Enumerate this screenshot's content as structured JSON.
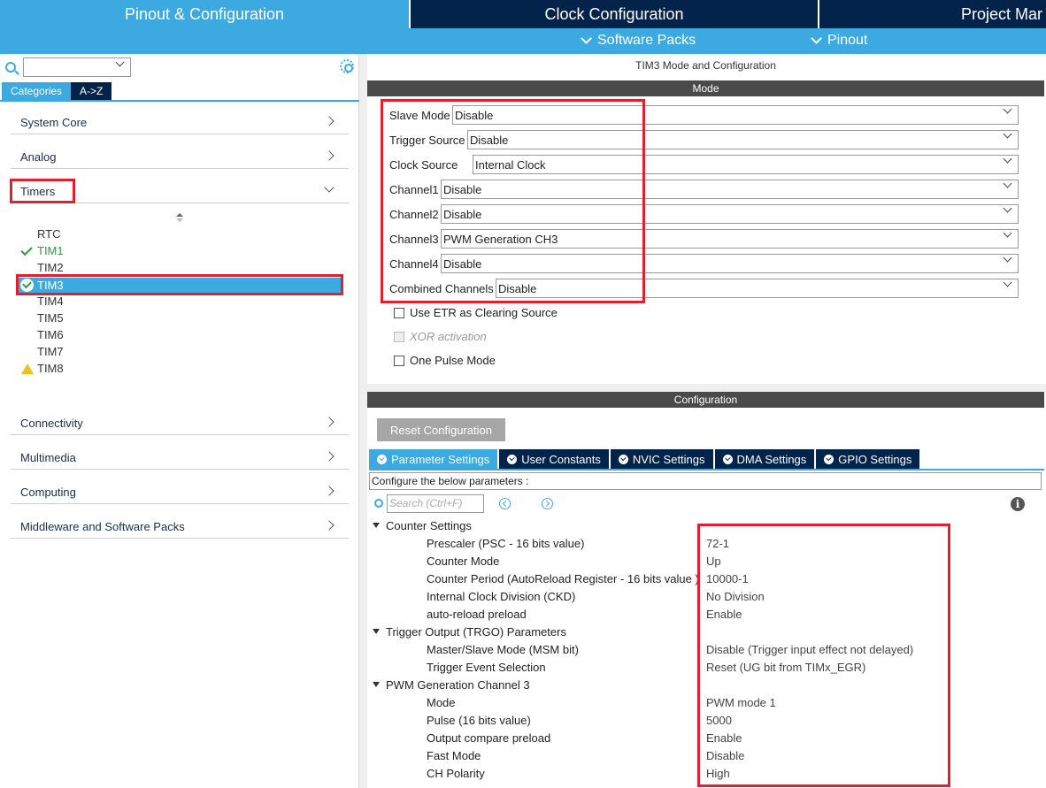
{
  "top_tabs": [
    "Pinout & Configuration",
    "Clock Configuration",
    "Project Mar"
  ],
  "sub_bar": {
    "software_packs": "Software Packs",
    "pinout": "Pinout"
  },
  "sidebar": {
    "tabs": [
      "Categories",
      "A->Z"
    ],
    "categories": [
      "System Core",
      "Analog",
      "Timers",
      "Connectivity",
      "Multimedia",
      "Computing",
      "Middleware and Software Packs"
    ],
    "timers": [
      "RTC",
      "TIM1",
      "TIM2",
      "TIM3",
      "TIM4",
      "TIM5",
      "TIM6",
      "TIM7",
      "TIM8"
    ]
  },
  "panel": {
    "title": "TIM3 Mode and Configuration",
    "mode_header": "Mode",
    "config_header": "Configuration"
  },
  "mode": {
    "rows": [
      {
        "label": "Slave Mode",
        "value": "Disable"
      },
      {
        "label": "Trigger Source",
        "value": "Disable"
      },
      {
        "label": "Clock Source",
        "value": "Internal Clock"
      },
      {
        "label": "Channel1",
        "value": "Disable"
      },
      {
        "label": "Channel2",
        "value": "Disable"
      },
      {
        "label": "Channel3",
        "value": "PWM Generation CH3"
      },
      {
        "label": "Channel4",
        "value": "Disable"
      },
      {
        "label": "Combined Channels",
        "value": "Disable"
      }
    ],
    "checkboxes": [
      "Use ETR as Clearing Source",
      "XOR activation",
      "One Pulse Mode"
    ]
  },
  "config": {
    "reset_label": "Reset Configuration",
    "tabs": [
      "Parameter Settings",
      "User Constants",
      "NVIC Settings",
      "DMA Settings",
      "GPIO Settings"
    ],
    "note": "Configure the below parameters :",
    "search_placeholder": "Search (Ctrl+F)",
    "groups": [
      {
        "name": "Counter Settings",
        "params": [
          {
            "name": "Prescaler (PSC - 16 bits value)",
            "value": "72-1"
          },
          {
            "name": "Counter Mode",
            "value": "Up"
          },
          {
            "name": "Counter Period (AutoReload Register - 16 bits value )",
            "value": "10000-1"
          },
          {
            "name": "Internal Clock Division (CKD)",
            "value": "No Division"
          },
          {
            "name": "auto-reload preload",
            "value": "Enable"
          }
        ]
      },
      {
        "name": "Trigger Output (TRGO) Parameters",
        "params": [
          {
            "name": "Master/Slave Mode (MSM bit)",
            "value": "Disable (Trigger input effect not delayed)"
          },
          {
            "name": "Trigger Event Selection",
            "value": "Reset (UG bit from TIMx_EGR)"
          }
        ]
      },
      {
        "name": "PWM Generation Channel 3",
        "params": [
          {
            "name": "Mode",
            "value": "PWM mode 1"
          },
          {
            "name": "Pulse (16 bits value)",
            "value": "5000"
          },
          {
            "name": "Output compare preload",
            "value": "Enable"
          },
          {
            "name": "Fast Mode",
            "value": "Disable"
          },
          {
            "name": "CH Polarity",
            "value": "High"
          }
        ]
      }
    ]
  }
}
